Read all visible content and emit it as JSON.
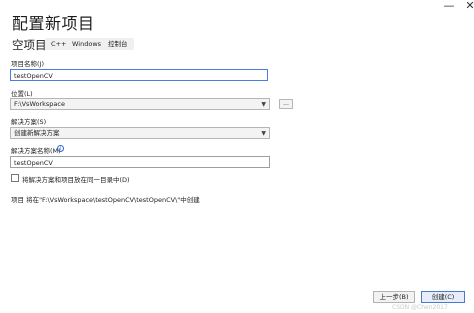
{
  "window": {
    "title": "配置新项目",
    "minimize": "—",
    "close": "✕"
  },
  "template": {
    "name": "空项目",
    "tags": [
      "C++",
      "Windows",
      "控制台"
    ]
  },
  "form": {
    "project_name_label": "项目名称(J)",
    "project_name_value": "testOpenCV",
    "location_label": "位置(L)",
    "location_value": "F:\\VsWorkspace",
    "browse_label": "...",
    "solution_label": "解决方案(S)",
    "solution_value": "创建新解决方案",
    "solution_name_label": "解决方案名称(M)",
    "solution_name_value": "testOpenCV",
    "info_icon": "i",
    "same_dir_label": "将解决方案和项目放在同一目录中(D)",
    "same_dir_checked": false,
    "path_note": "项目 将在\"F:\\VsWorkspace\\testOpenCV\\testOpenCV\\\"中创建"
  },
  "footer": {
    "back_label": "上一步(B)",
    "create_label": "创建(C)"
  },
  "watermark": "CSDN @Chen2017"
}
